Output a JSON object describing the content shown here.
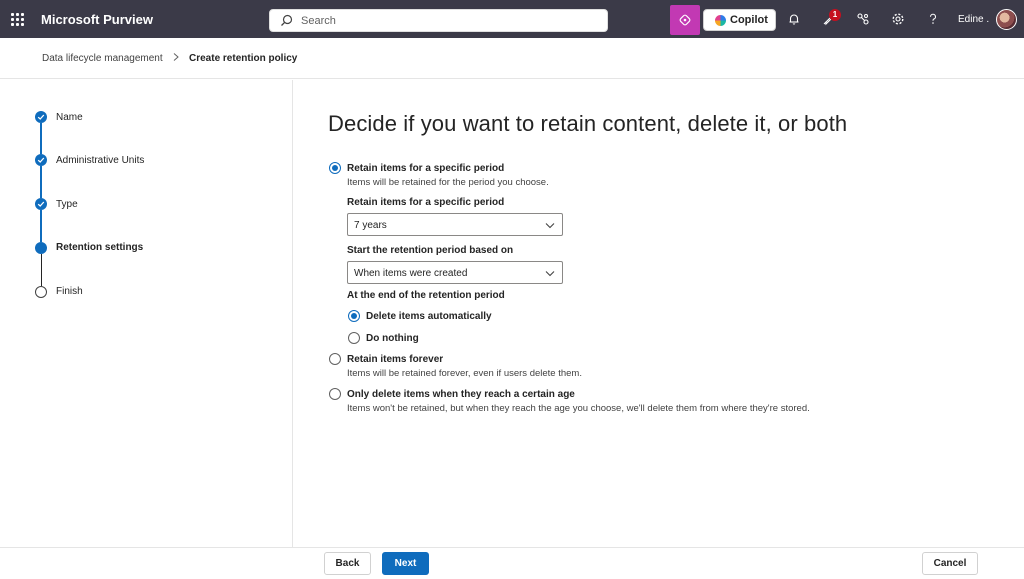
{
  "topbar": {
    "app_title": "Microsoft Purview",
    "search_placeholder": "Search",
    "copilot_label": "Copilot",
    "notification_count": "1",
    "user_name": "Edine ."
  },
  "breadcrumb": {
    "parent": "Data lifecycle management",
    "current": "Create retention policy"
  },
  "steps": [
    {
      "label": "Name",
      "state": "done"
    },
    {
      "label": "Administrative Units",
      "state": "done"
    },
    {
      "label": "Type",
      "state": "done"
    },
    {
      "label": "Retention settings",
      "state": "current"
    },
    {
      "label": "Finish",
      "state": "todo"
    }
  ],
  "main": {
    "heading": "Decide if you want to retain content, delete it, or both",
    "option_retain": {
      "label": "Retain items for a specific period",
      "desc": "Items will be retained for the period you choose.",
      "period_label": "Retain items for a specific period",
      "period_value": "7 years",
      "start_label": "Start the retention period based on",
      "start_value": "When items were created",
      "end_label": "At the end of the retention period",
      "end_delete": "Delete items automatically",
      "end_nothing": "Do nothing"
    },
    "option_forever": {
      "label": "Retain items forever",
      "desc": "Items will be retained forever, even if users delete them."
    },
    "option_delete_only": {
      "label": "Only delete items when they reach a certain age",
      "desc": "Items won't be retained, but when they reach the age you choose, we'll delete them from where they're stored."
    }
  },
  "footer": {
    "back_label": "Back",
    "next_label": "Next",
    "cancel_label": "Cancel"
  },
  "colors": {
    "topbar": "#3b3a48",
    "accent": "#0f6cbd",
    "copilot_button": "#c239b3"
  }
}
